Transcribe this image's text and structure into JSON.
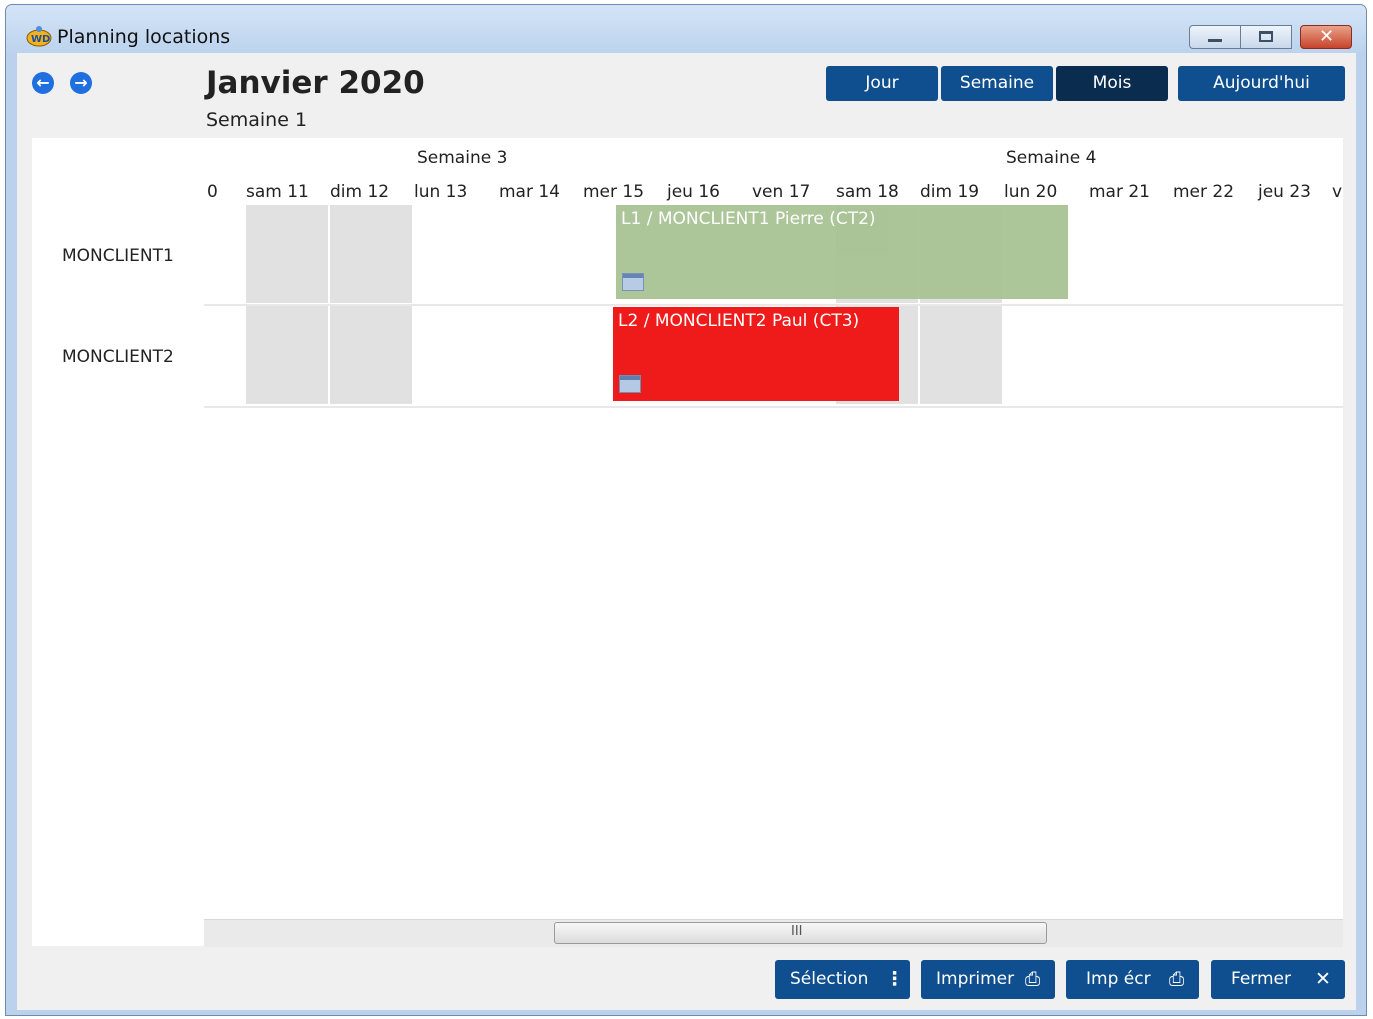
{
  "window": {
    "title": "Planning locations"
  },
  "header": {
    "month_title": "Janvier 2020",
    "week_subtitle": "Semaine 1",
    "prev_icon": "arrow-left-circle-icon",
    "next_icon": "arrow-right-circle-icon"
  },
  "views": {
    "day": "Jour",
    "week": "Semaine",
    "month": "Mois",
    "today": "Aujourd'hui",
    "active": "Mois"
  },
  "planning": {
    "weeks": [
      "Semaine 3",
      "Semaine 4"
    ],
    "days": [
      "0",
      "sam 11",
      "dim 12",
      "lun 13",
      "mar 14",
      "mer 15",
      "jeu 16",
      "ven 17",
      "sam 18",
      "dim 19",
      "lun 20",
      "mar 21",
      "mer 22",
      "jeu 23",
      "v"
    ],
    "rows": [
      {
        "label": "MONCLIENT1"
      },
      {
        "label": "MONCLIENT2"
      }
    ],
    "events": [
      {
        "label": "L1 / MONCLIENT1 Pierre (CT2)",
        "color": "#a9c394",
        "row": "MONCLIENT1"
      },
      {
        "label": "L2 / MONCLIENT2 Paul (CT3)",
        "color": "#ef1a1a",
        "row": "MONCLIENT2"
      }
    ],
    "scroll_grip": "III"
  },
  "footer": {
    "selection": "Sélection",
    "print": "Imprimer",
    "print_screen": "Imp écr",
    "close": "Fermer"
  },
  "colors": {
    "button_blue": "#0f4f8f",
    "button_active": "#0a2d4f",
    "weekend": "#e1e1e1"
  }
}
